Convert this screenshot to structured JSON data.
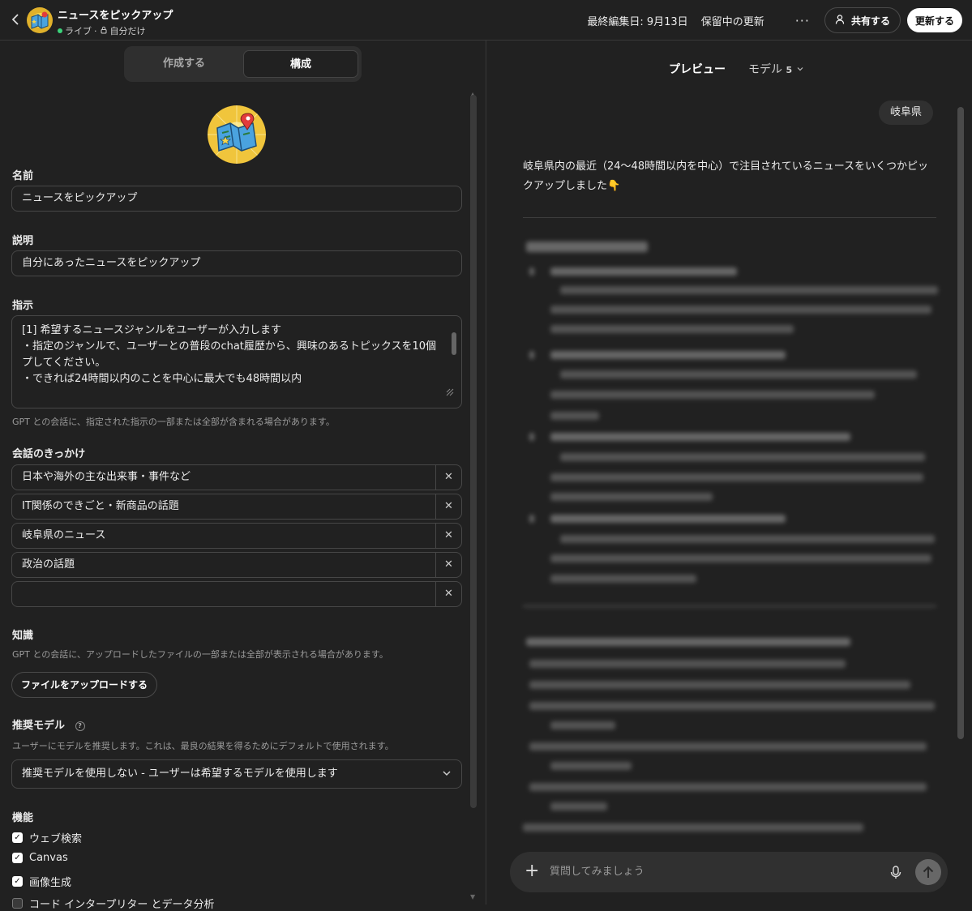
{
  "header": {
    "back_label": "‹",
    "title": "ニュースをピックアップ",
    "status": "ライブ",
    "visibility": "自分だけ",
    "last_edited": "最終編集日: 9月13日",
    "pending": "保留中の更新",
    "more": "···",
    "share": "共有する",
    "update": "更新する"
  },
  "editor": {
    "tabs": [
      "作成する",
      "構成"
    ],
    "name_label": "名前",
    "name_value": "ニュースをピックアップ",
    "desc_label": "説明",
    "desc_value": "自分にあったニュースをピックアップ",
    "instr_label": "指示",
    "instr_lines": [
      "[1] 希望するニュースジャンルをユーザーが入力します",
      "・指定のジャンルで、ユーザーとの普段のchat履歴から、興味のあるトピックスを10個ピックアッ",
      "プしてください。",
      "・できれば24時間以内のことを中心に最大でも48時間以内"
    ],
    "instr_hint": "GPT との会話に、指定された指示の一部または全部が含まれる場合があります。",
    "starters_label": "会話のきっかけ",
    "starters": [
      "日本や海外の主な出来事・事件など",
      "IT関係のできごと・新商品の話題",
      "岐阜県のニュース",
      "政治の話題",
      ""
    ],
    "knowledge_label": "知識",
    "knowledge_hint": "GPT との会話に、アップロードしたファイルの一部または全部が表示される場合があります。",
    "upload": "ファイルをアップロードする",
    "model_label": "推奨モデル",
    "model_help": "?",
    "model_hint": "ユーザーにモデルを推奨します。これは、最良の結果を得るためにデフォルトで使用されます。",
    "model_value": "推奨モデルを使用しない - ユーザーは希望するモデルを使用します",
    "capabilities_label": "機能",
    "capabilities": [
      {
        "label": "ウェブ検索",
        "checked": true
      },
      {
        "label": "Canvas",
        "checked": true
      },
      {
        "label": "画像生成",
        "checked": true
      },
      {
        "label": "コード インタープリター とデータ分析",
        "checked": false
      }
    ]
  },
  "preview": {
    "title": "プレビュー",
    "model": "モデル",
    "model_version": "5",
    "user_message": "岐阜県",
    "answer": "岐阜県内の最近（24〜48時間以内を中心）で注目されているニュースをいくつかピックアップしました👇",
    "composer_placeholder": "質問してみましょう"
  },
  "icons": {
    "back": "chevron-left-icon",
    "lock": "lock-icon",
    "share": "user-plus-icon",
    "chevron": "chevron-down-icon",
    "close": "close-icon",
    "plus": "plus-icon",
    "mic": "microphone-icon",
    "send": "arrow-up-icon"
  },
  "colors": {
    "background": "#212121",
    "live": "#3bd37a",
    "border": "#474747"
  }
}
